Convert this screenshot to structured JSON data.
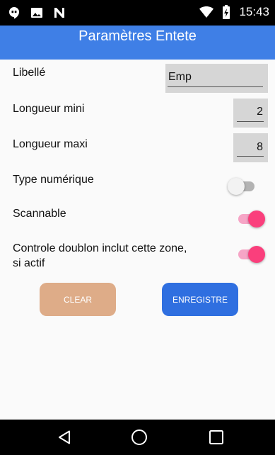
{
  "status_bar": {
    "time": "15:43",
    "left_icons": [
      "hangouts-icon",
      "image-icon",
      "n-logo-icon"
    ],
    "right_icons": [
      "wifi-icon",
      "battery-icon"
    ]
  },
  "app_bar": {
    "title": "Paramètres Entete",
    "color": "#3f7fe6"
  },
  "form": {
    "libelle": {
      "label": "Libellé",
      "value": "Emp"
    },
    "longueur_mini": {
      "label": "Longueur mini",
      "value": "2"
    },
    "longueur_maxi": {
      "label": "Longueur maxi",
      "value": "8"
    },
    "type_numerique": {
      "label": "Type numérique",
      "checked": false
    },
    "scannable": {
      "label": "Scannable",
      "checked": true
    },
    "controle_doublon": {
      "label": "Controle doublon inclut cette zone, si actif",
      "checked": true
    }
  },
  "buttons": {
    "clear": {
      "label": "CLEAR",
      "color": "#deac88"
    },
    "enregistre": {
      "label": "ENREGISTRE",
      "color": "#2f6fe0"
    }
  },
  "switch_on_color": "#fa3f7c",
  "nav_bar": {
    "icons": [
      "back-icon",
      "home-icon",
      "recents-icon"
    ]
  }
}
